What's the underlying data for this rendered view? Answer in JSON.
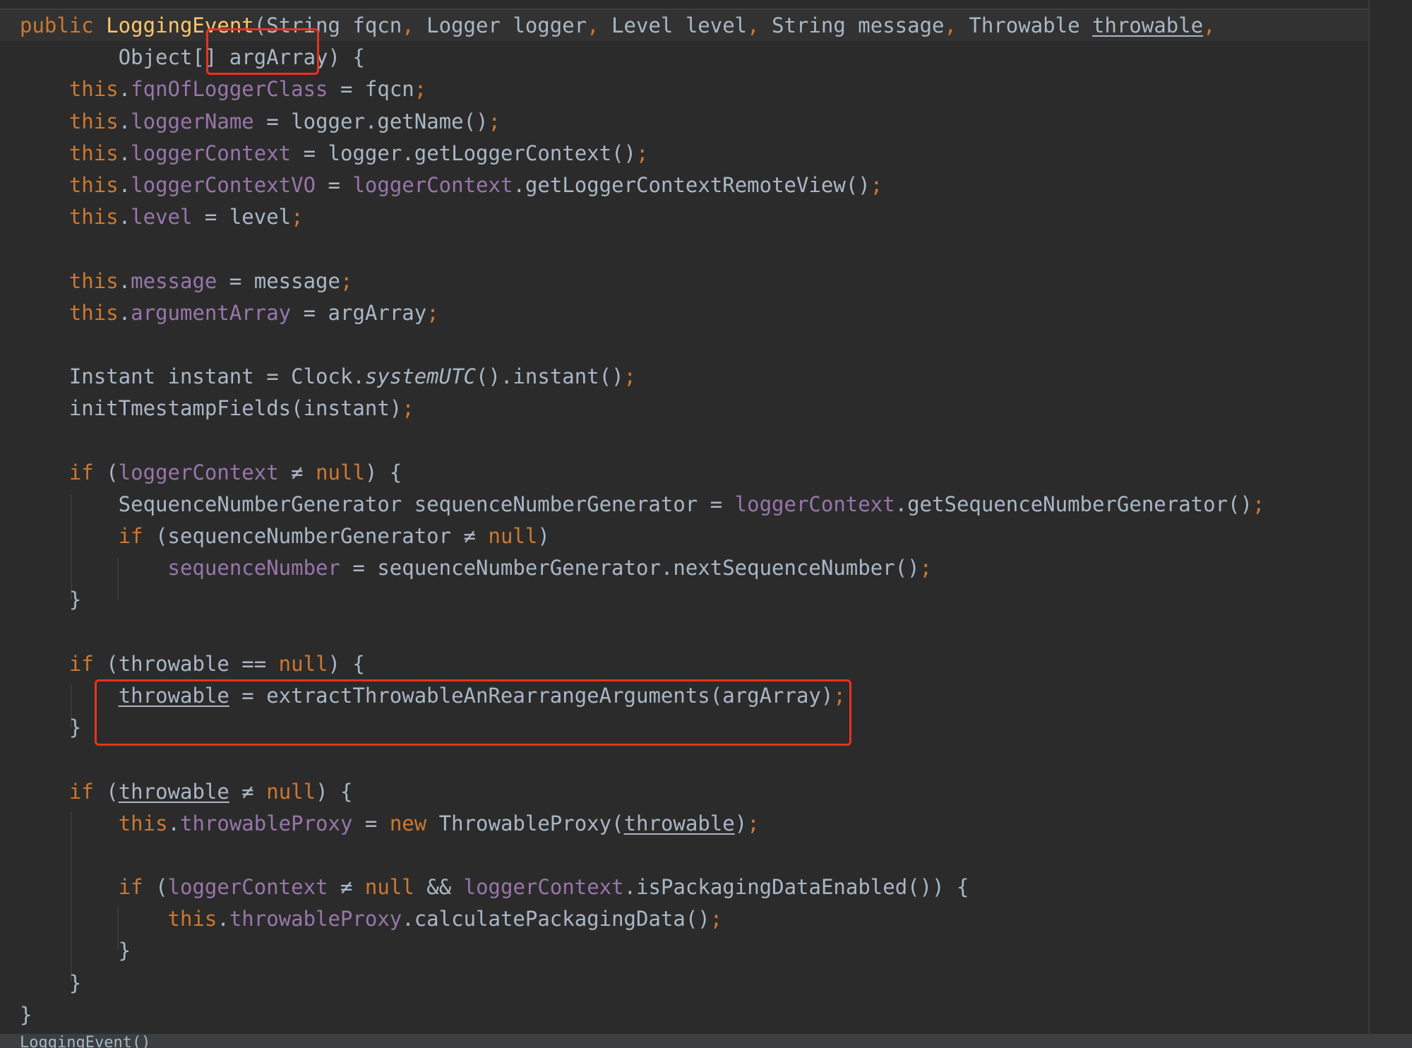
{
  "code_lines": [
    [
      {
        "t": "public ",
        "c": "kw"
      },
      {
        "t": "LoggingEvent",
        "c": "fn"
      },
      {
        "t": "(String fqcn"
      },
      {
        "t": ", ",
        "c": "kw"
      },
      {
        "t": "Logger logger"
      },
      {
        "t": ", ",
        "c": "kw"
      },
      {
        "t": "Level level"
      },
      {
        "t": ", ",
        "c": "kw"
      },
      {
        "t": "String message"
      },
      {
        "t": ", ",
        "c": "kw"
      },
      {
        "t": "Throwable "
      },
      {
        "t": "throwable",
        "c": "ul"
      },
      {
        "t": ",",
        "c": "kw"
      }
    ],
    [
      {
        "t": "        Object[] argArray) {"
      }
    ],
    [
      {
        "t": "    "
      },
      {
        "t": "this",
        "c": "kw"
      },
      {
        "t": "."
      },
      {
        "t": "fqnOfLoggerClass",
        "c": "fld"
      },
      {
        "t": " = fqcn"
      },
      {
        "t": ";",
        "c": "kw"
      }
    ],
    [
      {
        "t": "    "
      },
      {
        "t": "this",
        "c": "kw"
      },
      {
        "t": "."
      },
      {
        "t": "loggerName",
        "c": "fld"
      },
      {
        "t": " = logger.getName()"
      },
      {
        "t": ";",
        "c": "kw"
      }
    ],
    [
      {
        "t": "    "
      },
      {
        "t": "this",
        "c": "kw"
      },
      {
        "t": "."
      },
      {
        "t": "loggerContext",
        "c": "fld"
      },
      {
        "t": " = logger.getLoggerContext()"
      },
      {
        "t": ";",
        "c": "kw"
      }
    ],
    [
      {
        "t": "    "
      },
      {
        "t": "this",
        "c": "kw"
      },
      {
        "t": "."
      },
      {
        "t": "loggerContextVO",
        "c": "fld"
      },
      {
        "t": " = "
      },
      {
        "t": "loggerContext",
        "c": "fld"
      },
      {
        "t": ".getLoggerContextRemoteView()"
      },
      {
        "t": ";",
        "c": "kw"
      }
    ],
    [
      {
        "t": "    "
      },
      {
        "t": "this",
        "c": "kw"
      },
      {
        "t": "."
      },
      {
        "t": "level",
        "c": "fld"
      },
      {
        "t": " = level"
      },
      {
        "t": ";",
        "c": "kw"
      }
    ],
    [],
    [
      {
        "t": "    "
      },
      {
        "t": "this",
        "c": "kw"
      },
      {
        "t": "."
      },
      {
        "t": "message",
        "c": "fld"
      },
      {
        "t": " = message"
      },
      {
        "t": ";",
        "c": "kw"
      }
    ],
    [
      {
        "t": "    "
      },
      {
        "t": "this",
        "c": "kw"
      },
      {
        "t": "."
      },
      {
        "t": "argumentArray",
        "c": "fld"
      },
      {
        "t": " = argArray"
      },
      {
        "t": ";",
        "c": "kw"
      }
    ],
    [],
    [
      {
        "t": "    Instant instant = Clock."
      },
      {
        "t": "systemUTC",
        "c": "it"
      },
      {
        "t": "().instant()"
      },
      {
        "t": ";",
        "c": "kw"
      }
    ],
    [
      {
        "t": "    initTmestampFields(instant)"
      },
      {
        "t": ";",
        "c": "kw"
      }
    ],
    [],
    [
      {
        "t": "    "
      },
      {
        "t": "if ",
        "c": "kw"
      },
      {
        "t": "("
      },
      {
        "t": "loggerContext",
        "c": "fld"
      },
      {
        "t": " ≠ "
      },
      {
        "t": "null",
        "c": "kw"
      },
      {
        "t": ") {"
      }
    ],
    [
      {
        "t": "        SequenceNumberGenerator sequenceNumberGenerator = "
      },
      {
        "t": "loggerContext",
        "c": "fld"
      },
      {
        "t": ".getSequenceNumberGenerator()"
      },
      {
        "t": ";",
        "c": "kw"
      }
    ],
    [
      {
        "t": "        "
      },
      {
        "t": "if ",
        "c": "kw"
      },
      {
        "t": "(sequenceNumberGenerator ≠ "
      },
      {
        "t": "null",
        "c": "kw"
      },
      {
        "t": ")"
      }
    ],
    [
      {
        "t": "            "
      },
      {
        "t": "sequenceNumber",
        "c": "fld"
      },
      {
        "t": " = sequenceNumberGenerator.nextSequenceNumber()"
      },
      {
        "t": ";",
        "c": "kw"
      }
    ],
    [
      {
        "t": "    }"
      }
    ],
    [],
    [
      {
        "t": "    "
      },
      {
        "t": "if ",
        "c": "kw"
      },
      {
        "t": "(throwable == "
      },
      {
        "t": "null",
        "c": "kw"
      },
      {
        "t": ") {"
      }
    ],
    [
      {
        "t": "        "
      },
      {
        "t": "throwable",
        "c": "ul"
      },
      {
        "t": " = extractThrowableAnRearrangeArguments(argArray)"
      },
      {
        "t": ";",
        "c": "kw"
      }
    ],
    [
      {
        "t": "    }"
      }
    ],
    [],
    [
      {
        "t": "    "
      },
      {
        "t": "if ",
        "c": "kw"
      },
      {
        "t": "("
      },
      {
        "t": "throwable",
        "c": "ul"
      },
      {
        "t": " ≠ "
      },
      {
        "t": "null",
        "c": "kw"
      },
      {
        "t": ") {"
      }
    ],
    [
      {
        "t": "        "
      },
      {
        "t": "this",
        "c": "kw"
      },
      {
        "t": "."
      },
      {
        "t": "throwableProxy",
        "c": "fld"
      },
      {
        "t": " = "
      },
      {
        "t": "new ",
        "c": "kw"
      },
      {
        "t": "ThrowableProxy("
      },
      {
        "t": "throwable",
        "c": "ul"
      },
      {
        "t": ")"
      },
      {
        "t": ";",
        "c": "kw"
      }
    ],
    [],
    [
      {
        "t": "        "
      },
      {
        "t": "if ",
        "c": "kw"
      },
      {
        "t": "("
      },
      {
        "t": "loggerContext",
        "c": "fld"
      },
      {
        "t": " ≠ "
      },
      {
        "t": "null ",
        "c": "kw"
      },
      {
        "t": "&& "
      },
      {
        "t": "loggerContext",
        "c": "fld"
      },
      {
        "t": ".isPackagingDataEnabled()) {"
      }
    ],
    [
      {
        "t": "            "
      },
      {
        "t": "this",
        "c": "kw"
      },
      {
        "t": "."
      },
      {
        "t": "throwableProxy",
        "c": "fld"
      },
      {
        "t": ".calculatePackagingData()"
      },
      {
        "t": ";",
        "c": "kw"
      }
    ],
    [
      {
        "t": "        }"
      }
    ],
    [
      {
        "t": "    }"
      }
    ],
    [
      {
        "t": "}"
      }
    ]
  ],
  "status_text": "LoggingEvent()",
  "colors": {
    "background": "#2b2b2b",
    "keyword": "#cc7832",
    "method_decl": "#ffc66d",
    "field": "#9876aa",
    "text": "#a9b7c6",
    "highlight_box": "#e8321f"
  }
}
